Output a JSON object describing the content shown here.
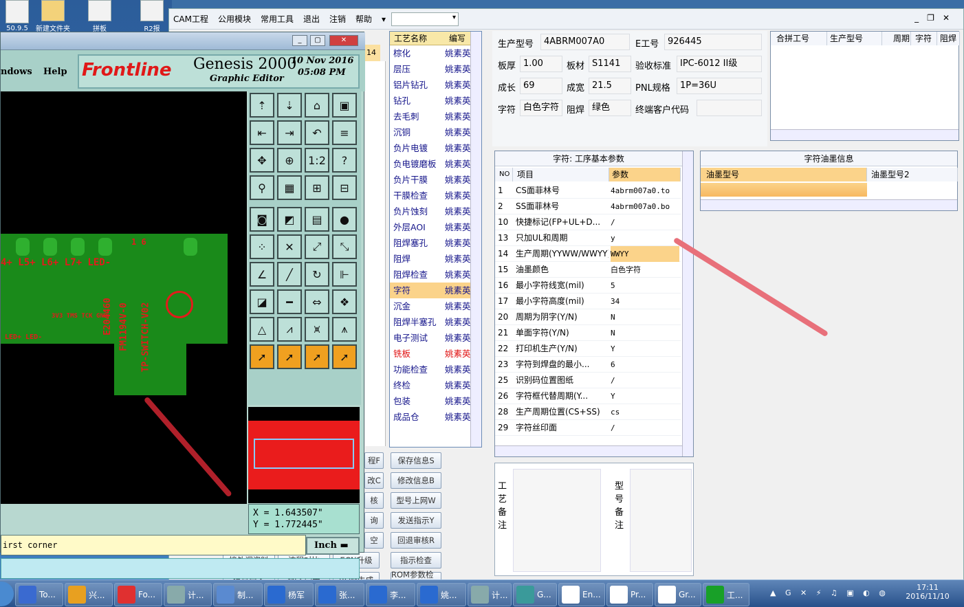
{
  "desktop": {
    "icons": [
      {
        "label": "50.9.5"
      },
      {
        "label": "新建文件夹"
      },
      {
        "label": "拼板"
      },
      {
        "label": "R2报"
      }
    ]
  },
  "cam": {
    "menu": [
      "CAM工程",
      "公用模块",
      "常用工具",
      "退出",
      "注销",
      "帮助"
    ],
    "help_arrow": "▾",
    "combo_value": "",
    "left_strip_value": "14",
    "process_list": {
      "headers": [
        "工艺名称",
        "编写"
      ],
      "rows": [
        {
          "name": "棕化",
          "owner": "姚素英"
        },
        {
          "name": "层压",
          "owner": "姚素英"
        },
        {
          "name": "铝片钻孔",
          "owner": "姚素英"
        },
        {
          "name": "钻孔",
          "owner": "姚素英"
        },
        {
          "name": "去毛刺",
          "owner": "姚素英"
        },
        {
          "name": "沉铜",
          "owner": "姚素英"
        },
        {
          "name": "负片电镀",
          "owner": "姚素英"
        },
        {
          "name": "负电镀磨板",
          "owner": "姚素英"
        },
        {
          "name": "负片干膜",
          "owner": "姚素英"
        },
        {
          "name": "干膜检查",
          "owner": "姚素英"
        },
        {
          "name": "负片蚀刻",
          "owner": "姚素英"
        },
        {
          "name": "外层AOI",
          "owner": "姚素英"
        },
        {
          "name": "阻焊塞孔",
          "owner": "姚素英"
        },
        {
          "name": "阻焊",
          "owner": "姚素英"
        },
        {
          "name": "阻焊检查",
          "owner": "姚素英"
        },
        {
          "name": "字符",
          "owner": "姚素英",
          "selected": true
        },
        {
          "name": "沉金",
          "owner": "姚素英"
        },
        {
          "name": "阻焊半塞孔",
          "owner": "姚素英"
        },
        {
          "name": "电子测试",
          "owner": "姚素英"
        },
        {
          "name": "铣板",
          "owner": "姚素英",
          "red": true
        },
        {
          "name": "功能检查",
          "owner": "姚素英"
        },
        {
          "name": "终检",
          "owner": "姚素英"
        },
        {
          "name": "包装",
          "owner": "姚素英"
        },
        {
          "name": "成品仓",
          "owner": "姚素英"
        }
      ]
    },
    "bottom_buttons": [
      {
        "label": "保存信息S"
      },
      {
        "label": "修改信息B"
      },
      {
        "label": "型号上网W"
      },
      {
        "label": "发送指示Y"
      },
      {
        "label": "回退审核R"
      },
      {
        "label": "指示检查"
      },
      {
        "label": "ROM参数检查"
      }
    ],
    "bottom_left_buttons": [
      {
        "label": "程F"
      },
      {
        "label": "改C"
      },
      {
        "label": "核"
      },
      {
        "label": "询"
      },
      {
        "label": "空"
      },
      {
        "label": "接外调资料"
      },
      {
        "label": "流程对比"
      },
      {
        "label": "ECN升级"
      },
      {
        "label": "信息导入"
      },
      {
        "label": "MES同步"
      },
      {
        "label": "ROM生成"
      }
    ],
    "info": {
      "model_label": "生产型号",
      "model_value": "4ABRM007A0",
      "eno_label": "E工号",
      "eno_value": "926445",
      "thick_label": "板厚",
      "thick_value": "1.00",
      "mat_label": "板材",
      "mat_value": "S1141",
      "std_label": "验收标准",
      "std_value": "IPC-6012 II级",
      "len_label": "成长",
      "len_value": "69",
      "wid_label": "成宽",
      "wid_value": "21.5",
      "pnl_label": "PNL规格",
      "pnl_value": "1P=36U",
      "char_label": "字符",
      "char_value": "白色字符",
      "mask_label": "阻焊",
      "mask_value": "绿色",
      "cust_label": "终端客户代码",
      "cust_value": ""
    },
    "merge_table": {
      "headers": [
        "合拼工号",
        "生产型号",
        "周期",
        "字符",
        "阻焊"
      ]
    },
    "params": {
      "title": "字符: 工序基本参数",
      "headers": [
        "NO",
        "项目",
        "参数"
      ],
      "rows": [
        {
          "no": "1",
          "item": "CS面菲林号",
          "val": "4abrm007a0.to"
        },
        {
          "no": "2",
          "item": "SS面菲林号",
          "val": "4abrm007a0.bo"
        },
        {
          "no": "10",
          "item": "快捷标记(FP+UL+D...",
          "val": "/"
        },
        {
          "no": "13",
          "item": "只加UL和周期",
          "val": "y"
        },
        {
          "no": "14",
          "item": "生产周期(YYWW/WWYY)",
          "val": "WWYY",
          "hl": true
        },
        {
          "no": "15",
          "item": "油墨颜色",
          "val": "白色字符"
        },
        {
          "no": "16",
          "item": "最小字符线宽(mil)",
          "val": "5"
        },
        {
          "no": "17",
          "item": "最小字符高度(mil)",
          "val": "34"
        },
        {
          "no": "20",
          "item": "周期为阴字(Y/N)",
          "val": "N"
        },
        {
          "no": "21",
          "item": "单面字符(Y/N)",
          "val": "N"
        },
        {
          "no": "22",
          "item": "打印机生产(Y/N)",
          "val": "Y"
        },
        {
          "no": "23",
          "item": "字符到焊盘的最小...",
          "val": "6"
        },
        {
          "no": "25",
          "item": "识别码位置图纸",
          "val": "/"
        },
        {
          "no": "26",
          "item": "字符框代替周期(Y...",
          "val": "Y"
        },
        {
          "no": "28",
          "item": "生产周期位置(CS+SS)",
          "val": "cs"
        },
        {
          "no": "29",
          "item": "字符丝印面",
          "val": "/"
        }
      ]
    },
    "ink": {
      "title": "字符油墨信息",
      "headers": [
        "油墨型号",
        "油墨型号2"
      ]
    },
    "notes": {
      "process_label": "工艺备注",
      "model_label": "型号备注"
    }
  },
  "genesis": {
    "menu": [
      "ndows",
      "Help"
    ],
    "brand": "Frontline",
    "product": "Genesis 2000",
    "subtitle": "Graphic Editor",
    "date": "10 Nov 2016",
    "time": "05:08 PM",
    "board_labels": [
      "4+ L5+ L6+ L7+ LED-",
      "LED+ LED-",
      "3V3 TMS TCK GND",
      "1 6",
      "E204460",
      "FM1194V-0",
      "TP-SWITCH-V02"
    ],
    "coord_x": "X = 1.643507\"",
    "coord_y": "Y = 1.772445\"",
    "prompt": "irst corner",
    "unit": "Inch"
  },
  "taskbar": {
    "items": [
      {
        "label": "To..."
      },
      {
        "label": "兴..."
      },
      {
        "label": "Fo..."
      },
      {
        "label": "计..."
      },
      {
        "label": "制..."
      },
      {
        "label": "杨军"
      },
      {
        "label": "张..."
      },
      {
        "label": "李..."
      },
      {
        "label": "姚..."
      },
      {
        "label": "计..."
      },
      {
        "label": "G..."
      },
      {
        "label": "En..."
      },
      {
        "label": "Pr..."
      },
      {
        "label": "Gr..."
      },
      {
        "label": "工..."
      }
    ],
    "clock_time": "17:11",
    "clock_date": "2016/11/10"
  },
  "colors": {
    "accent": "#fbd38a",
    "annotation_arrow": "#e8707a",
    "genesis_panel": "#a8d0c8",
    "pcb_green": "#1a8a1a",
    "pcb_red": "#e21b1b"
  }
}
